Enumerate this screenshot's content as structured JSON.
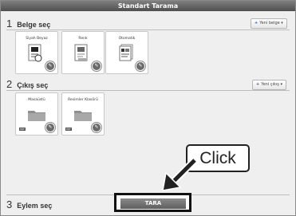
{
  "window": {
    "title": "Standart Tarama"
  },
  "section1": {
    "number": "1",
    "label": "Belge seç",
    "add_button": "Yeni belge",
    "cards": [
      {
        "label": "Siyah Beyaz"
      },
      {
        "label": "Renk"
      },
      {
        "label": "Otomatik"
      }
    ]
  },
  "section2": {
    "number": "2",
    "label": "Çıkış seç",
    "add_button": "Yeni çıkış",
    "cards": [
      {
        "label": "Masaüstü",
        "tag": "PDF"
      },
      {
        "label": "Resimler Klasörü",
        "tag": "PDF"
      }
    ]
  },
  "section3": {
    "number": "3",
    "label": "Eylem seç",
    "scan_button": "TARA"
  },
  "callout": {
    "text": "Click"
  },
  "colors": {
    "accent": "#1e5fbf",
    "titlebar": "#5a5a5a",
    "button": "#6e6e6e"
  }
}
